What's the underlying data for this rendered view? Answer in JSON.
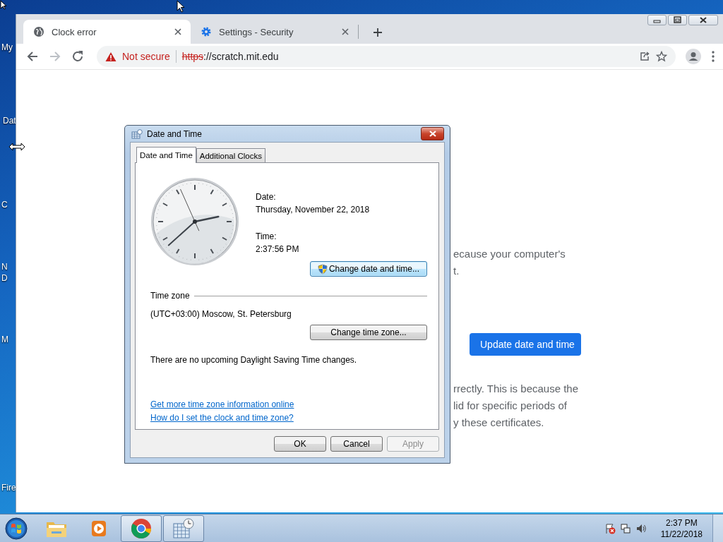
{
  "desktop": {
    "icons": [
      {
        "label": "My"
      },
      {
        "label": "Dat"
      },
      {
        "label": "C"
      },
      {
        "label": "N"
      },
      {
        "label": "D"
      },
      {
        "label": "M"
      },
      {
        "label": "Fire"
      }
    ]
  },
  "browser": {
    "tabs": [
      {
        "label": "Clock error",
        "selected": true,
        "kind": "globe"
      },
      {
        "label": "Settings - Security",
        "selected": false,
        "kind": "gear"
      }
    ],
    "address_bar": {
      "security": "Not secure",
      "scheme": "https",
      "rest": "://scratch.mit.edu"
    },
    "page": {
      "paragraph_1": [
        "ecause your computer's",
        "t."
      ],
      "button": "Update date and time",
      "paragraph_2": [
        "rrectly. This is because the",
        "lid for specific periods of",
        "y these certificates."
      ]
    }
  },
  "dialog": {
    "title": "Date and Time",
    "tabs": [
      {
        "label": "Date and Time",
        "selected": true
      },
      {
        "label": "Additional Clocks",
        "selected": false
      }
    ],
    "date_label": "Date:",
    "date": "Thursday, November 22, 2018",
    "time_label": "Time:",
    "time": "2:37:56 PM",
    "change_date_button": "Change date and time...",
    "time_zone_heading": "Time zone",
    "time_zone": "(UTC+03:00) Moscow, St. Petersburg",
    "change_zone_button": "Change time zone...",
    "dst_note": "There are no upcoming Daylight Saving Time changes.",
    "links": [
      "Get more time zone information online",
      "How do I set the clock and time zone?"
    ],
    "buttons": [
      {
        "label": "OK",
        "disabled": false
      },
      {
        "label": "Cancel",
        "disabled": false
      },
      {
        "label": "Apply",
        "disabled": true
      }
    ]
  },
  "taskbar": {
    "buttons": [
      {
        "kind": "folder",
        "active": false
      },
      {
        "kind": "media",
        "active": false
      },
      {
        "kind": "browser",
        "active": true
      },
      {
        "kind": "calendar",
        "active": true
      }
    ],
    "clock_time": "2:37 PM",
    "clock_date": "11/22/2018"
  }
}
